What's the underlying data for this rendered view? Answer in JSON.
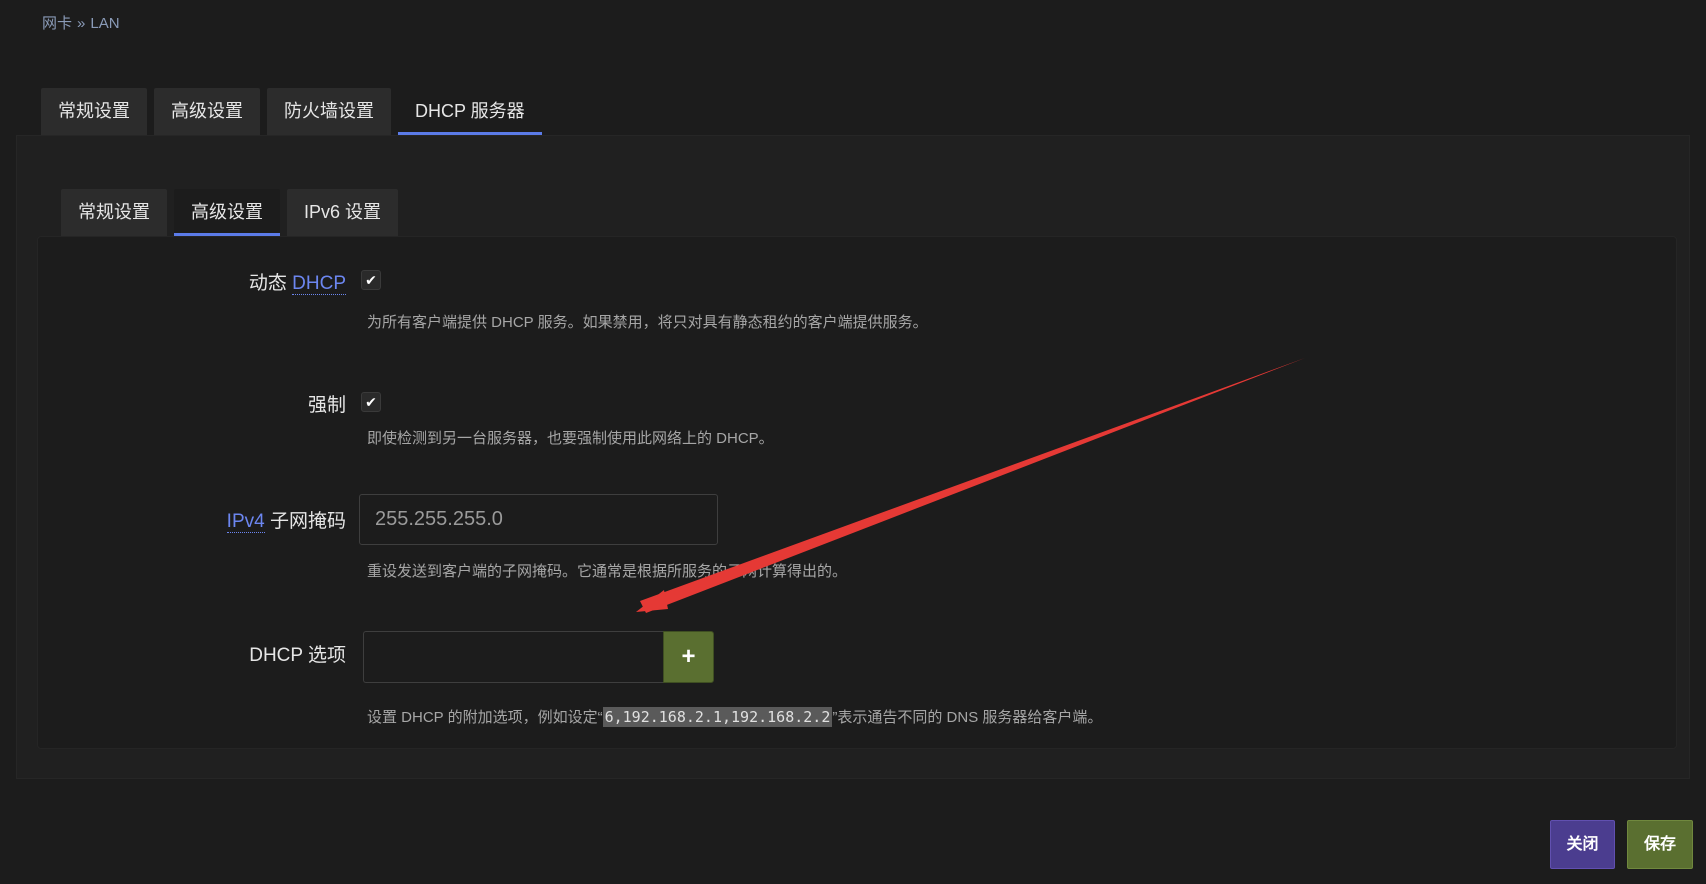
{
  "breadcrumb": {
    "parent": "网卡",
    "separator": "»",
    "current": "LAN"
  },
  "outer_tabs": [
    {
      "label": "常规设置",
      "active": false
    },
    {
      "label": "高级设置",
      "active": false
    },
    {
      "label": "防火墙设置",
      "active": false
    },
    {
      "label": "DHCP 服务器",
      "active": true
    }
  ],
  "inner_tabs": [
    {
      "label": "常规设置",
      "active": false
    },
    {
      "label": "高级设置",
      "active": true
    },
    {
      "label": "IPv6 设置",
      "active": false
    }
  ],
  "fields": {
    "dynamic_dhcp": {
      "label_prefix": "动态",
      "label_link": "DHCP",
      "checked": true,
      "description": "为所有客户端提供 DHCP 服务。如果禁用，将只对具有静态租约的客户端提供服务。"
    },
    "force": {
      "label": "强制",
      "checked": true,
      "description": "即使检测到另一台服务器，也要强制使用此网络上的 DHCP。"
    },
    "netmask": {
      "label_link": "IPv4",
      "label_suffix": "子网掩码",
      "placeholder": "255.255.255.0",
      "value": "",
      "description": "重设发送到客户端的子网掩码。它通常是根据所服务的子网计算得出的。"
    },
    "dhcp_options": {
      "label": "DHCP 选项",
      "value": "",
      "add_label": "+",
      "description_before": "设置 DHCP 的附加选项，例如设定“",
      "description_code": "6,192.168.2.1,192.168.2.2",
      "description_after": "”表示通告不同的 DNS 服务器给客户端。"
    }
  },
  "actions": {
    "close": "关闭",
    "save": "保存"
  },
  "colors": {
    "background": "#1c1c1c",
    "tab_active_underline": "#5b7be8",
    "link": "#6c86f0",
    "close_button": "#4b3d8f",
    "save_button": "#5a6f30",
    "annotation_arrow": "#e53935"
  }
}
